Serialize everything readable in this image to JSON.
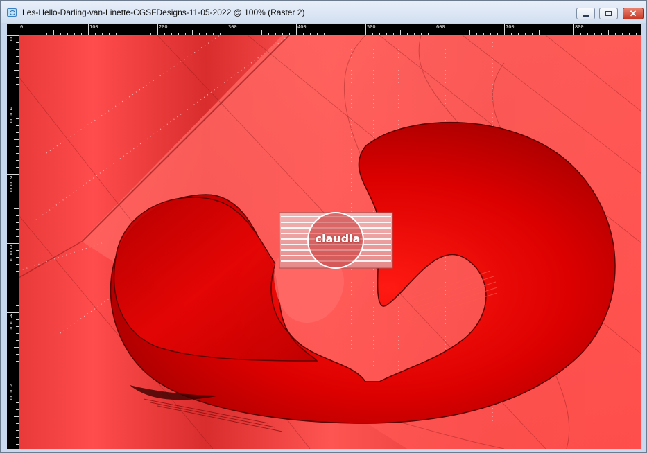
{
  "window": {
    "title": "Les-Hello-Darling-van-Linette-CGSFDesigns-11-05-2022 @ 100% (Raster 2)",
    "icon": "image-document-icon",
    "controls": {
      "minimize_icon": "minimize-icon",
      "maximize_icon": "maximize-icon",
      "close_icon": "close-icon",
      "close_label": "✕"
    }
  },
  "rulers": {
    "top_labels": [
      "0",
      "100",
      "200",
      "300",
      "400",
      "500",
      "600",
      "700",
      "800"
    ],
    "left_labels": [
      "0",
      "100",
      "200",
      "300",
      "400",
      "500"
    ]
  },
  "canvas": {
    "description_colors": {
      "base": "#e23a3a",
      "light": "#ff5a58",
      "dark": "#b80808",
      "shape": "#e40000"
    },
    "watermark": {
      "text": "claudia",
      "icon": "claudia-watermark-logo"
    }
  }
}
